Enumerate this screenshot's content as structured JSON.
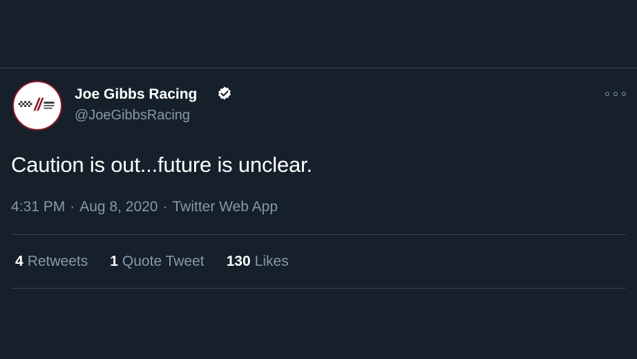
{
  "tweet": {
    "display_name": "Joe Gibbs Racing",
    "handle": "@JoeGibbsRacing",
    "verified": true,
    "avatar_logo": "Joe Gibbs Racing checkered-flag logo",
    "text": "Caution is out...future is unclear.",
    "time": "4:31 PM",
    "separator": "·",
    "date": "Aug 8, 2020",
    "source": "Twitter Web App"
  },
  "stats": {
    "retweets_count": "4",
    "retweets_label": "Retweets",
    "quotes_count": "1",
    "quotes_label": "Quote Tweet",
    "likes_count": "130",
    "likes_label": "Likes"
  },
  "icons": {
    "verified": "verified-badge-icon",
    "more": "more-options-icon"
  },
  "colors": {
    "background": "#15202b",
    "divider": "#38444d",
    "secondary_text": "#8899a6",
    "primary_text": "#ffffff",
    "logo_accent": "#8b1a2b"
  }
}
